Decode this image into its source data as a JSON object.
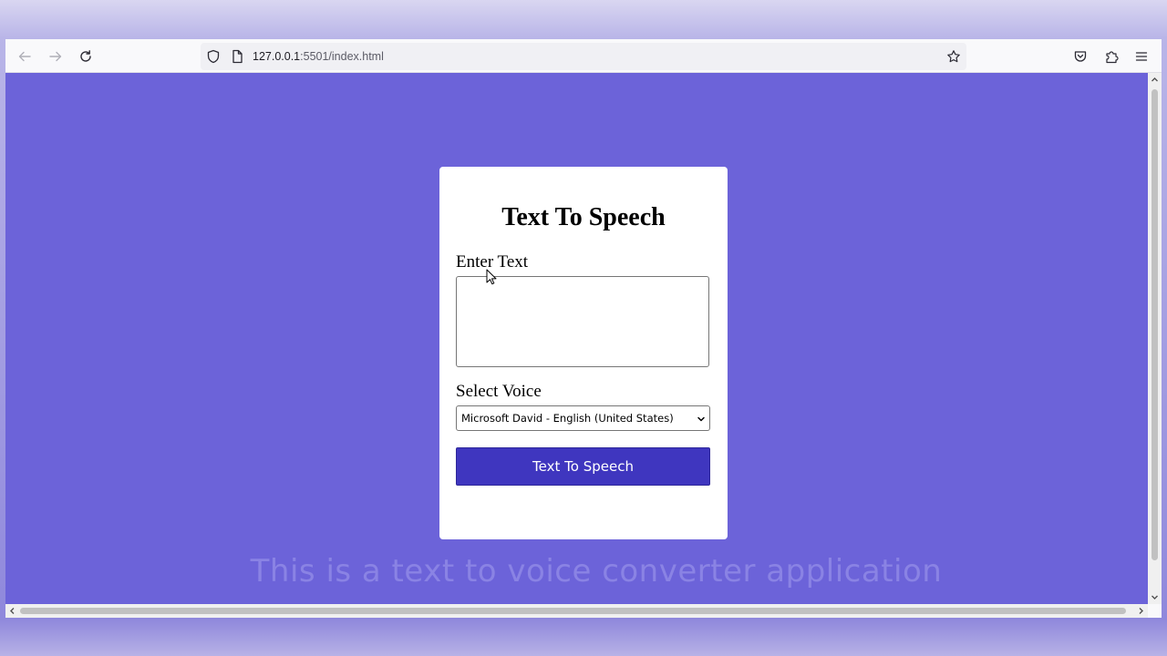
{
  "browser": {
    "url_host": "127.0.0.1",
    "url_rest": ":5501/index.html",
    "icons": {
      "back": "arrow-left-icon",
      "forward": "arrow-right-icon",
      "reload": "reload-icon",
      "shield": "shield-icon",
      "page": "page-icon",
      "bookmark": "star-icon",
      "pocket": "pocket-icon",
      "extensions": "extensions-icon",
      "menu": "hamburger-menu-icon"
    }
  },
  "app": {
    "title": "Text To Speech",
    "text_label": "Enter Text",
    "text_value": "",
    "voice_label": "Select Voice",
    "voice_selected": "Microsoft David - English (United States)",
    "button_label": "Text To Speech"
  },
  "caption": "This is a text to voice converter application",
  "colors": {
    "page_background": "#6c63d9",
    "button": "#3f36bf",
    "card": "#ffffff",
    "caption": "#8a83e4"
  }
}
